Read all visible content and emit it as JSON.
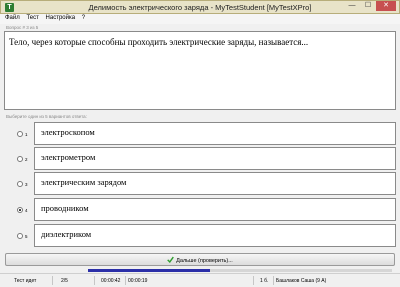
{
  "window": {
    "title": "Делимость электрического заряда - MyTestStudent [MyTestXPro]",
    "minimize_label": "—",
    "maximize_label": "☐",
    "close_label": "✕",
    "app_icon_label": "T"
  },
  "menu": [
    "Файл",
    "Тест",
    "Настройка",
    "?"
  ],
  "question": {
    "label": "Вопрос # 3 из 5",
    "text": "Тело, через которые способны проходить электрические заряды, называется..."
  },
  "answers_hint": "Выберите один из 5 вариантов ответа:",
  "answers": [
    {
      "num": "1",
      "text": "электроскопом",
      "selected": false
    },
    {
      "num": "2",
      "text": "электрометром",
      "selected": false
    },
    {
      "num": "3",
      "text": "электрическим зарядом",
      "selected": false
    },
    {
      "num": "4",
      "text": "проводником",
      "selected": true
    },
    {
      "num": "5",
      "text": "диэлектриком",
      "selected": false
    }
  ],
  "next_button": {
    "label": "Дальше (проверить)...",
    "icon": "check-icon"
  },
  "progress": {
    "fraction": 0.4
  },
  "status": {
    "state": "Тест идет",
    "count": "2/5",
    "elapsed": "00:00:42",
    "question_time": "00:00:19",
    "question_no": "1 б.",
    "user": "Башлаков Саша (9 А)"
  }
}
